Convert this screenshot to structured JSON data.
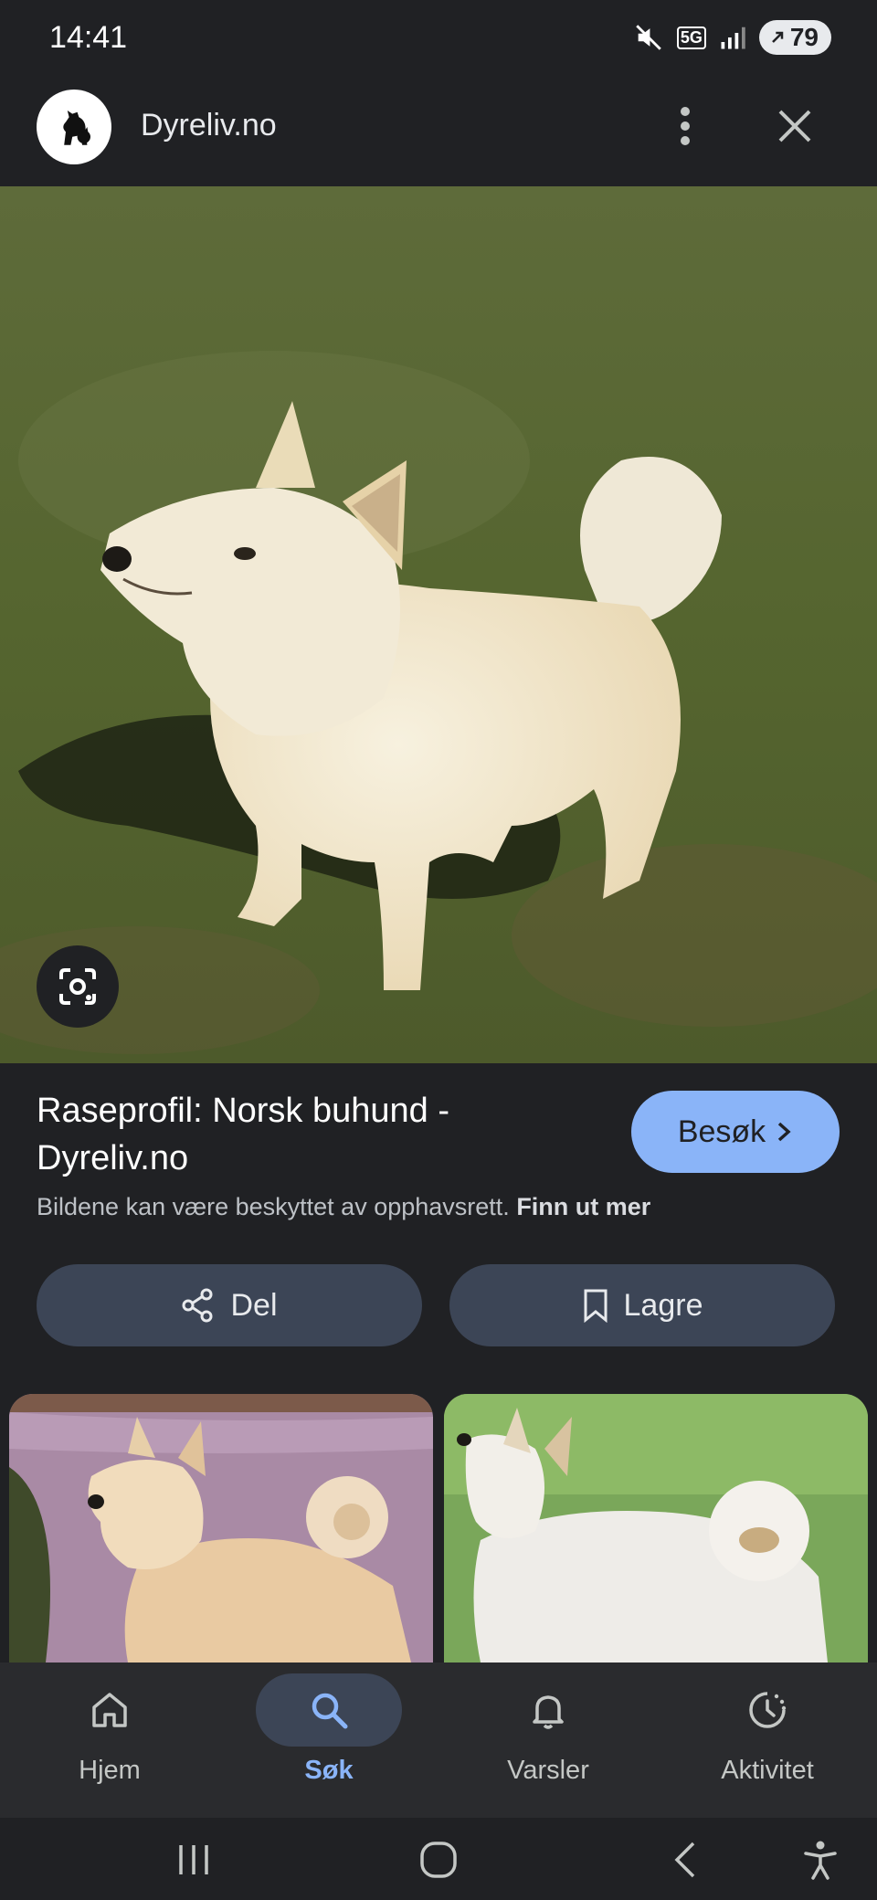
{
  "status_bar": {
    "time": "14:41",
    "network": "5G",
    "battery": "79"
  },
  "header": {
    "site_name": "Dyreliv.no"
  },
  "result": {
    "title": "Raseprofil: Norsk buhund - Dyreliv.no",
    "visit_label": "Besøk",
    "copyright_text": "Bildene kan være beskyttet av opphavsrett.",
    "learn_more": "Finn ut mer"
  },
  "actions": {
    "share_label": "Del",
    "save_label": "Lagre"
  },
  "bottom_nav": {
    "items": [
      {
        "label": "Hjem",
        "icon": "home-icon",
        "active": false
      },
      {
        "label": "Søk",
        "icon": "search-icon",
        "active": true
      },
      {
        "label": "Varsler",
        "icon": "bell-icon",
        "active": false
      },
      {
        "label": "Aktivitet",
        "icon": "activity-icon",
        "active": false
      }
    ]
  },
  "colors": {
    "background": "#202124",
    "accent": "#8ab4f8",
    "button": "#3c4556"
  }
}
